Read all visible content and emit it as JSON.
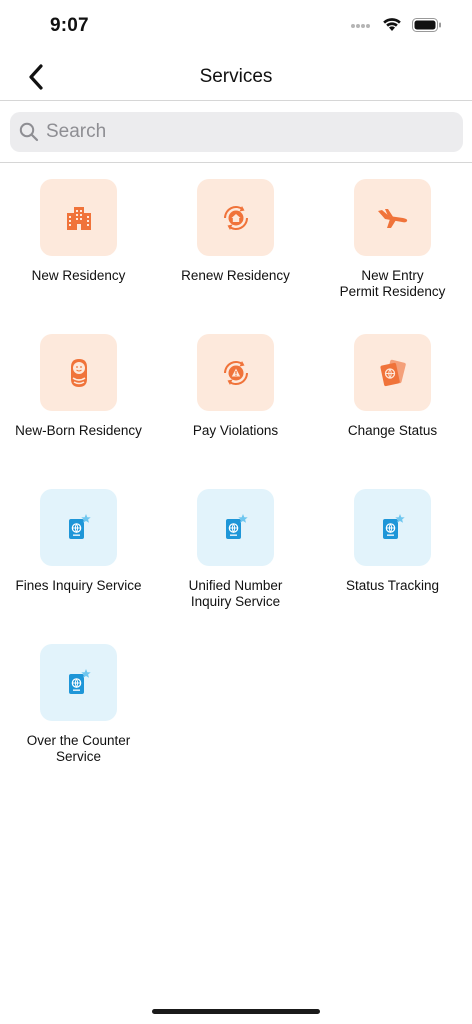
{
  "status_bar": {
    "time": "9:07"
  },
  "nav": {
    "title": "Services"
  },
  "search": {
    "placeholder": "Search",
    "value": ""
  },
  "services": [
    {
      "label": "New Residency",
      "icon": "building-icon",
      "tint": "orange"
    },
    {
      "label": "Renew Residency",
      "icon": "renew-home-icon",
      "tint": "orange"
    },
    {
      "label": "New Entry\nPermit Residency",
      "icon": "airplane-icon",
      "tint": "orange"
    },
    {
      "label": "New-Born Residency",
      "icon": "baby-icon",
      "tint": "orange"
    },
    {
      "label": "Pay Violations",
      "icon": "warning-cycle-icon",
      "tint": "orange"
    },
    {
      "label": "Change Status",
      "icon": "passports-icon",
      "tint": "orange"
    },
    {
      "label": "Fines Inquiry Service",
      "icon": "passport-star-icon",
      "tint": "blue"
    },
    {
      "label": "Unified Number\nInquiry Service",
      "icon": "passport-star-icon",
      "tint": "blue"
    },
    {
      "label": "Status Tracking",
      "icon": "passport-star-icon",
      "tint": "blue"
    },
    {
      "label": "Over the Counter\nService",
      "icon": "passport-star-icon",
      "tint": "blue"
    }
  ],
  "colors": {
    "orange_tile": "#fde9dc",
    "orange_icon": "#f0733a",
    "blue_tile": "#e2f3fb",
    "blue_icon": "#1e96d8"
  }
}
